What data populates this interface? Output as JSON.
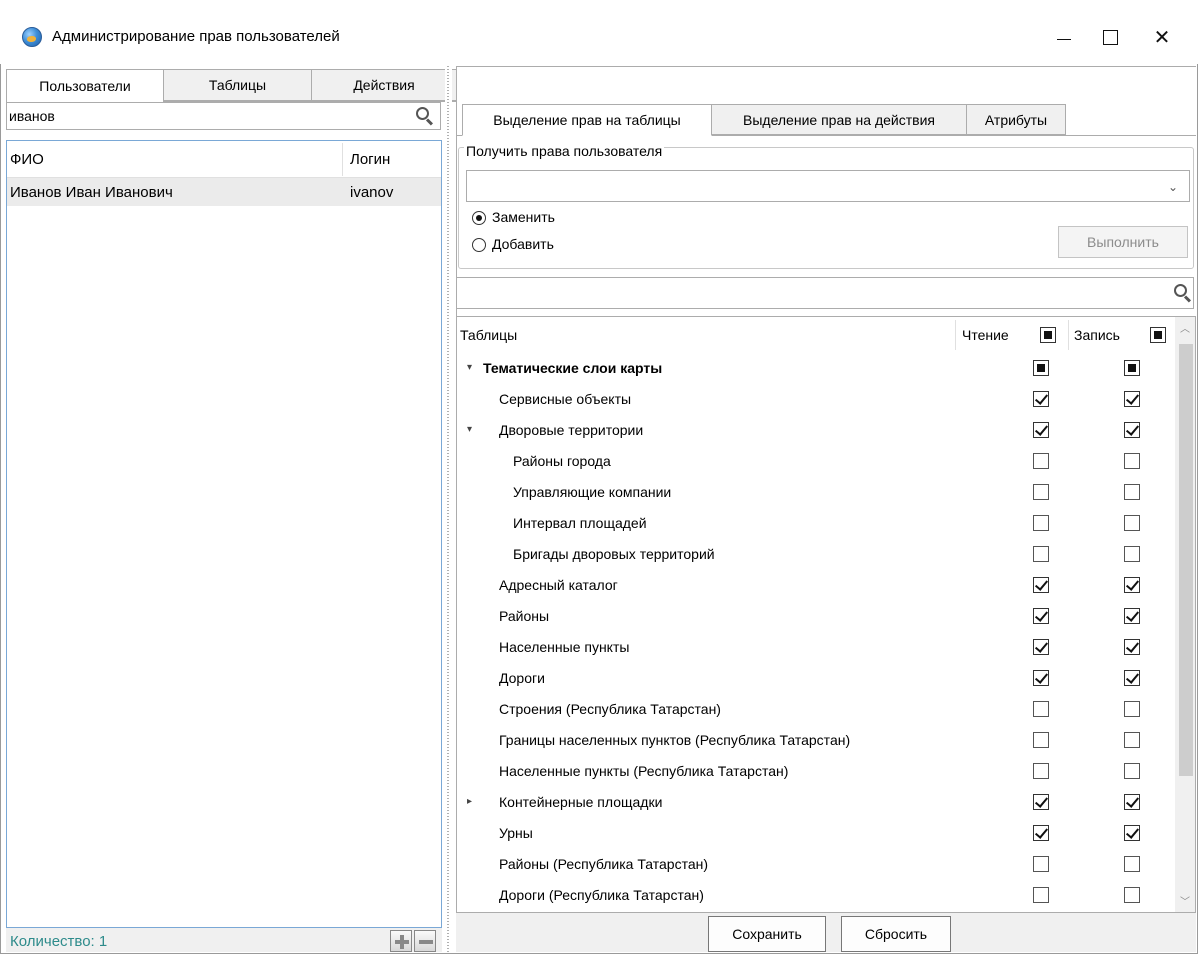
{
  "window": {
    "title": "Администрирование прав пользователей"
  },
  "left_tabs": [
    "Пользователи",
    "Таблицы",
    "Действия"
  ],
  "user_search": {
    "value": "иванов"
  },
  "users_grid": {
    "columns": [
      "ФИО",
      "Логин"
    ],
    "rows": [
      {
        "fio": "Иванов Иван Иванович",
        "login": "ivanov"
      }
    ]
  },
  "left_footer": {
    "count_label": "Количество: 1"
  },
  "right_tabs": [
    "Выделение прав на таблицы",
    "Выделение прав на действия",
    "Атрибуты"
  ],
  "copy_rights": {
    "legend": "Получить права пользователя",
    "selected_user": "",
    "options": [
      "Заменить",
      "Добавить"
    ],
    "selected_option": "Заменить",
    "execute_label": "Выполнить"
  },
  "table_search": {
    "value": ""
  },
  "tree": {
    "columns": {
      "tables": "Таблицы",
      "read": "Чтение",
      "write": "Запись"
    },
    "header_read_state": "partial",
    "header_write_state": "partial",
    "rows": [
      {
        "label": "Тематические слои карты",
        "level": 0,
        "expander": "expanded",
        "bold": true,
        "read": "partial",
        "write": "partial"
      },
      {
        "label": "Сервисные объекты",
        "level": 1,
        "expander": "none",
        "read": "checked",
        "write": "checked"
      },
      {
        "label": "Дворовые территории",
        "level": 1,
        "expander": "expanded",
        "read": "checked",
        "write": "checked"
      },
      {
        "label": "Районы города",
        "level": 2,
        "expander": "none",
        "read": "unchecked",
        "write": "unchecked"
      },
      {
        "label": "Управляющие компании",
        "level": 2,
        "expander": "none",
        "read": "unchecked",
        "write": "unchecked"
      },
      {
        "label": "Интервал площадей",
        "level": 2,
        "expander": "none",
        "read": "unchecked",
        "write": "unchecked"
      },
      {
        "label": "Бригады дворовых территорий",
        "level": 2,
        "expander": "none",
        "read": "unchecked",
        "write": "unchecked"
      },
      {
        "label": "Адресный каталог",
        "level": 1,
        "expander": "none",
        "read": "checked",
        "write": "checked"
      },
      {
        "label": "Районы",
        "level": 1,
        "expander": "none",
        "read": "checked",
        "write": "checked"
      },
      {
        "label": "Населенные пункты",
        "level": 1,
        "expander": "none",
        "read": "checked",
        "write": "checked"
      },
      {
        "label": "Дороги",
        "level": 1,
        "expander": "none",
        "read": "checked",
        "write": "checked"
      },
      {
        "label": "Строения (Республика Татарстан)",
        "level": 1,
        "expander": "none",
        "read": "unchecked",
        "write": "unchecked"
      },
      {
        "label": "Границы населенных пунктов (Республика Татарстан)",
        "level": 1,
        "expander": "none",
        "read": "unchecked",
        "write": "unchecked"
      },
      {
        "label": "Населенные пункты (Республика Татарстан)",
        "level": 1,
        "expander": "none",
        "read": "unchecked",
        "write": "unchecked"
      },
      {
        "label": "Контейнерные площадки",
        "level": 1,
        "expander": "collapsed",
        "read": "checked",
        "write": "checked"
      },
      {
        "label": "Урны",
        "level": 1,
        "expander": "none",
        "read": "checked",
        "write": "checked"
      },
      {
        "label": "Районы (Республика Татарстан)",
        "level": 1,
        "expander": "none",
        "read": "unchecked",
        "write": "unchecked"
      },
      {
        "label": "Дороги (Республика Татарстан)",
        "level": 1,
        "expander": "none",
        "read": "unchecked",
        "write": "unchecked"
      }
    ]
  },
  "buttons": {
    "save": "Сохранить",
    "reset": "Сбросить"
  },
  "icons": {
    "app": "globe-icon",
    "search": "search-icon",
    "add": "plus-icon",
    "remove": "minus-icon"
  },
  "colors": {
    "count_text": "#2e8b8b",
    "selection_border": "#7aa8d6"
  }
}
